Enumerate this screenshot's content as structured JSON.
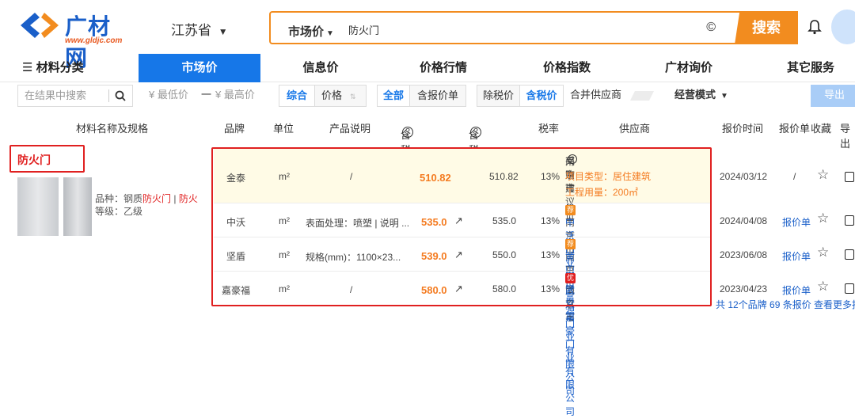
{
  "logo": {
    "text": "广材网",
    "url": "www.gldjc.com"
  },
  "header": {
    "province": "江苏省",
    "search_scope": "市场价",
    "search_keyword": "防火门",
    "search_button": "搜索",
    "copyright_glyph": "©"
  },
  "nav": {
    "category_label": "材料分类",
    "items": [
      "市场价",
      "信息价",
      "价格行情",
      "价格指数",
      "广材询价",
      "其它服务"
    ]
  },
  "filters": {
    "search_placeholder": "在结果中搜索",
    "min_price": "¥ 最低价",
    "dash": "一",
    "max_price": "¥ 最高价",
    "sort_comprehensive": "综合",
    "sort_price": "价格",
    "all": "全部",
    "with_quote": "含报价单",
    "ex_tax": "除税价",
    "incl_tax": "含税价",
    "merge_supplier": "合并供应商",
    "business_mode": "经营模式",
    "export": "导出"
  },
  "table_headers": {
    "name": "材料名称及规格",
    "brand": "品牌",
    "unit": "单位",
    "desc": "产品说明",
    "eng_price": "含税工程价",
    "mkt_price": "含税市场价",
    "tax": "税率",
    "supplier": "供应商",
    "date": "报价时间",
    "quote": "报价单",
    "fav": "收藏",
    "export": "导出"
  },
  "material": {
    "title": "防火门",
    "spec_prefix": "品种：钢质",
    "spec_hl1": "防火门",
    "spec_sep": " | ",
    "spec_hl2": "防火",
    "grade": "等级：乙级"
  },
  "rows": [
    {
      "brand": "金泰",
      "unit": "m²",
      "desc": "/",
      "eng_price": "510.82",
      "mkt_price": "510.82",
      "tax": "13%",
      "supplier_city": "南京市",
      "supplier_name": "采购建议价",
      "project_type": "项目类型：居住建筑",
      "usage": "工程用量：200㎡",
      "date": "2024/03/12",
      "quote": "/"
    },
    {
      "brand": "中沃",
      "unit": "m²",
      "desc": "表面处理：喷塑 | 说明 ...",
      "eng_price": "535.0",
      "mkt_price": "535.0",
      "tax": "13%",
      "badge1": "优",
      "badge2": "荐",
      "supplier_city": "南京市",
      "supplier_name": "中沃门业有限公司",
      "date": "2024/04/08",
      "quote": "报价单"
    },
    {
      "brand": "坚盾",
      "unit": "m²",
      "desc": "规格(mm)：1100×23...",
      "eng_price": "539.0",
      "mkt_price": "550.0",
      "tax": "13%",
      "badge1": "优",
      "badge2": "荐",
      "supplier_city": "南京市",
      "supplier_name": "黄山市富源门业有限公司",
      "date": "2023/06/08",
      "quote": "报价单"
    },
    {
      "brand": "嘉豪福",
      "unit": "m²",
      "desc": "/",
      "eng_price": "580.0",
      "mkt_price": "580.0",
      "tax": "13%",
      "badge1": "优",
      "supplier_city": "南京市",
      "supplier_name": "武义嘉豪门业有限公司",
      "date": "2023/04/23",
      "quote": "报价单"
    }
  ],
  "footer": {
    "summary": "共 12个品牌 69 条报价 查看更多报价"
  },
  "colors": {
    "accent": "#1677e8",
    "orange": "#f28c1f",
    "red_box": "#e02020",
    "highlight_row": "#fffbe6"
  }
}
